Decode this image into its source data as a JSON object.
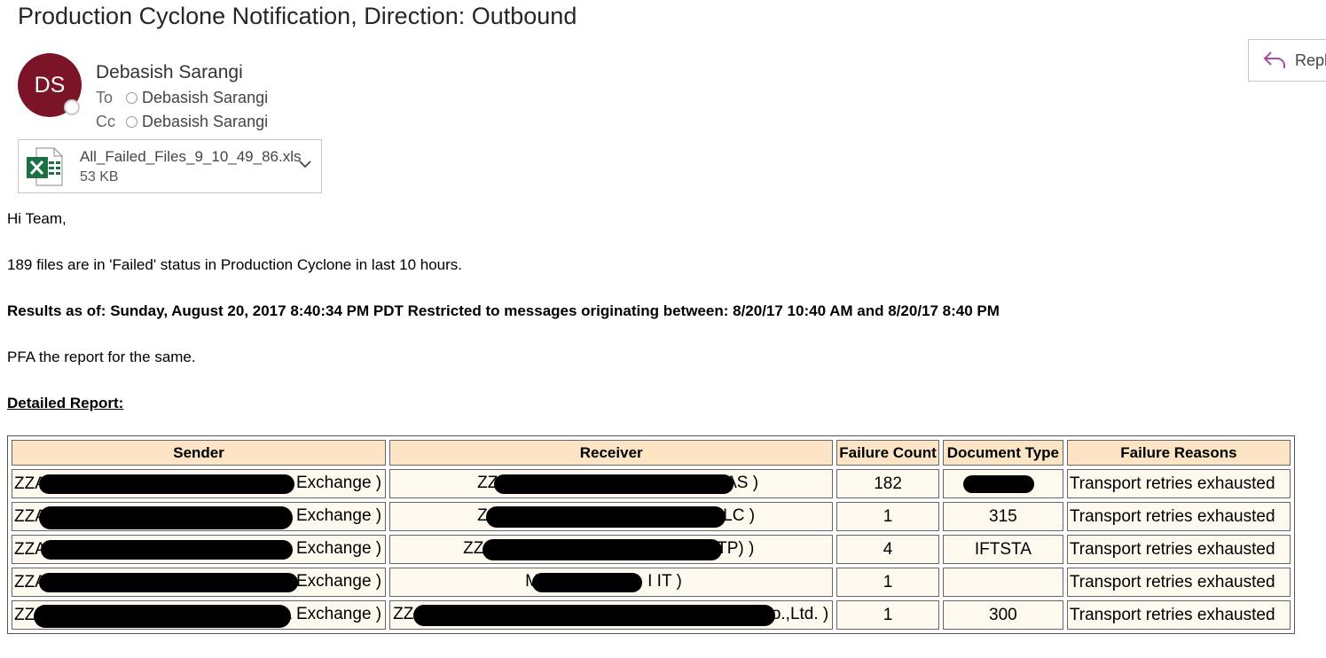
{
  "email": {
    "subject": "Production Cyclone Notification, Direction: Outbound",
    "sender": {
      "initials": "DS",
      "name": "Debasish Sarangi"
    },
    "to_label": "To",
    "to": "Debasish Sarangi",
    "cc_label": "Cc",
    "cc": "Debasish Sarangi",
    "reply_label": "Repl",
    "attachment": {
      "name": "All_Failed_Files_9_10_49_86.xls",
      "size": "53 KB"
    }
  },
  "body": {
    "greeting": "Hi Team,",
    "summary": "189 files are in 'Failed' status in Production Cyclone in last 10 hours.",
    "results": "Results as of: Sunday, August 20, 2017 8:40:34 PM PDT Restricted to messages originating between: 8/20/17 10:40 AM and 8/20/17 8:40 PM",
    "pfa": "PFA the report for the same.",
    "report_heading": "Detailed Report:"
  },
  "report": {
    "headers": [
      "Sender",
      "Receiver",
      "Failure Count",
      "Document Type",
      "Failure Reasons"
    ],
    "rows": [
      {
        "sender": "ZZA",
        "sender_end": "Exchange )",
        "receiver": "ZZ",
        "receiver_end": "AS )",
        "count": "182",
        "doc": "",
        "reason": "Transport retries exhausted"
      },
      {
        "sender": "ZZA",
        "sender_end": "Exchange )",
        "receiver": "Z",
        "receiver_end": "LC )",
        "count": "1",
        "doc": "315",
        "reason": "Transport retries exhausted"
      },
      {
        "sender": "ZZA",
        "sender_end": "Exchange )",
        "receiver": "ZZ",
        "receiver_end": "TP) )",
        "count": "4",
        "doc": "IFTSTA",
        "reason": "Transport retries exhausted"
      },
      {
        "sender": "ZZA",
        "sender_end": "Exchange )",
        "receiver": "M",
        "receiver_end": "I IT )",
        "count": "1",
        "doc": "",
        "reason": "Transport retries exhausted"
      },
      {
        "sender": "ZZ",
        "sender_end": "a Exchange )",
        "receiver": "ZZ",
        "receiver_end": "Co.,Ltd. )",
        "count": "1",
        "doc": "300",
        "reason": "Transport retries exhausted"
      }
    ]
  },
  "colors": {
    "avatar": "#7a1426",
    "header_bg": "#fce4c4",
    "cell_bg": "#fdf9ee",
    "excel_green": "#1d7044"
  }
}
